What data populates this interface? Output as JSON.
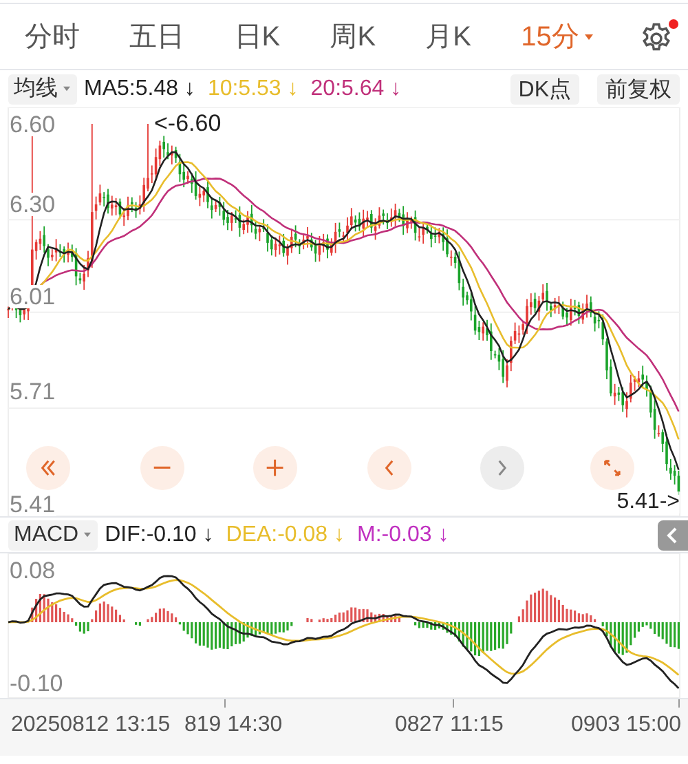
{
  "tabs": [
    {
      "label": "分时",
      "selected": false,
      "dropdown": false
    },
    {
      "label": "五日",
      "selected": false,
      "dropdown": false
    },
    {
      "label": "日K",
      "selected": false,
      "dropdown": false
    },
    {
      "label": "周K",
      "selected": false,
      "dropdown": false
    },
    {
      "label": "月K",
      "selected": false,
      "dropdown": false
    },
    {
      "label": "15分",
      "selected": true,
      "dropdown": true
    }
  ],
  "settings": {
    "badge": true
  },
  "ma_legend": {
    "selector": "均线",
    "items": [
      {
        "label": "MA5:5.48 ↓",
        "color": "#222222"
      },
      {
        "label": "10:5.53 ↓",
        "color": "#e8bd2c"
      },
      {
        "label": "20:5.64 ↓",
        "color": "#c0307a"
      }
    ],
    "buttons": [
      "DK点",
      "前复权"
    ]
  },
  "price_chart": {
    "y_labels": [
      "6.60",
      "6.30",
      "6.01",
      "5.71",
      "5.41"
    ],
    "high_marker": "<-6.60",
    "last_marker": "5.41->"
  },
  "controls": [
    {
      "kind": "fast-back",
      "disabled": false
    },
    {
      "kind": "zoom-out",
      "disabled": false
    },
    {
      "kind": "zoom-in",
      "disabled": false
    },
    {
      "kind": "back",
      "disabled": false
    },
    {
      "kind": "forward",
      "disabled": true
    },
    {
      "kind": "fullscreen",
      "disabled": false
    }
  ],
  "macd_legend": {
    "selector": "MACD",
    "items": [
      {
        "label": "DIF:-0.10 ↓",
        "color": "#222222"
      },
      {
        "label": "DEA:-0.08 ↓",
        "color": "#e8bd2c"
      },
      {
        "label": "M:-0.03 ↓",
        "color": "#c030c0"
      }
    ]
  },
  "macd_chart": {
    "y_labels": [
      "0.08",
      "-0.10"
    ]
  },
  "time_axis": [
    "20250812 13:15",
    "819 14:30",
    "0827 11:15",
    "0903 15:00"
  ]
}
